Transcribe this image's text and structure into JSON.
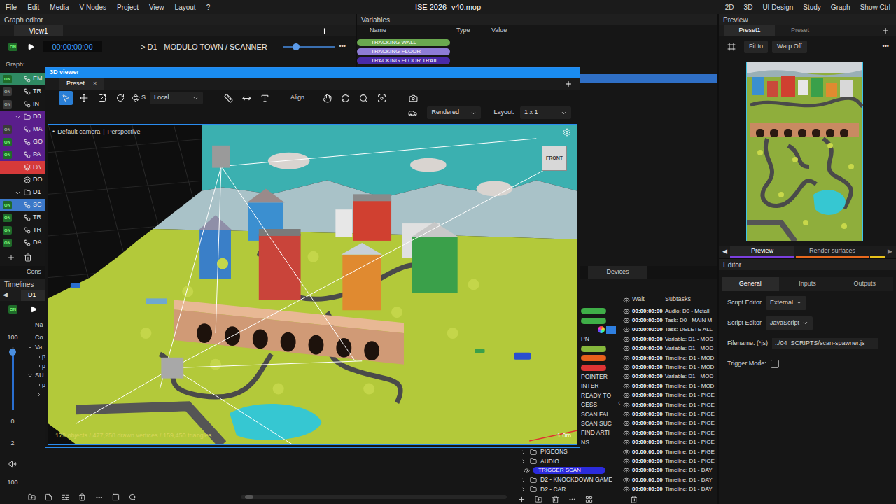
{
  "menu": [
    "File",
    "Edit",
    "Media",
    "V-Nodes",
    "Project",
    "View",
    "Layout",
    "?"
  ],
  "title": "ISE 2026 -v40.mop",
  "workspaces": [
    "2D",
    "3D",
    "UI Design",
    "Study",
    "Graph",
    "Show Ctrl"
  ],
  "graph_editor": {
    "title": "Graph editor",
    "tabs": [
      {
        "label": "View1",
        "selected": true
      }
    ],
    "on_label": "ON",
    "transport_on": true,
    "timecode": "00:00:00:00",
    "path": "> D1 - MODULO TOWN / SCANNER",
    "zoom": 0.22,
    "more": "•••",
    "graph_label": "Graph:",
    "rows": [
      {
        "kind": "node",
        "label": "EM",
        "on": true,
        "color": "#2f8a63"
      },
      {
        "kind": "node",
        "label": "TR",
        "on": false
      },
      {
        "kind": "node",
        "label": "IN",
        "on": false
      },
      {
        "kind": "folder",
        "label": "D0",
        "expanded": true,
        "color": "#5a1e8c"
      },
      {
        "kind": "node",
        "label": "MA",
        "on": false,
        "color": "#5a1e8c"
      },
      {
        "kind": "node",
        "label": "GO",
        "on": true,
        "color": "#5a1e8c"
      },
      {
        "kind": "node",
        "label": "PA",
        "on": true,
        "color": "#5a1e8c"
      },
      {
        "kind": "layer",
        "label": "PA",
        "color": "#d63a3a"
      },
      {
        "kind": "layer",
        "label": "DO"
      },
      {
        "kind": "folder",
        "label": "D1",
        "expanded": true
      },
      {
        "kind": "node",
        "label": "SC",
        "on": true,
        "color": "#3b78c8"
      },
      {
        "kind": "node",
        "label": "TR",
        "on": true
      },
      {
        "kind": "node",
        "label": "TR",
        "on": true
      },
      {
        "kind": "node",
        "label": "DA",
        "on": true
      }
    ]
  },
  "variables": {
    "title": "Variables",
    "columns": [
      "Name",
      "Type",
      "Value"
    ],
    "rows": [
      {
        "name": "TRACKING WALL",
        "color": "#6aa84f",
        "selected": false
      },
      {
        "name": "TRACKING FLOOR",
        "color": "#8e7cd6",
        "selected": false
      },
      {
        "name": "TRACKING FLOOR TRAIL",
        "color": "#4a2aa8",
        "selected": false
      },
      {
        "name": "",
        "selected": false
      },
      {
        "name": "",
        "selected": true
      }
    ]
  },
  "panel_tabs": {
    "left": "Cons",
    "right": "Devices"
  },
  "timelines": {
    "title": "Timelines",
    "prev": "◀",
    "tabs": [
      {
        "label": "D1 -",
        "selected": true
      }
    ],
    "on": true,
    "name_header": "Na",
    "volume_max": "100",
    "volume_level": 0.97,
    "volume_min": "0",
    "speed": "2",
    "gain": "100",
    "tree": [
      {
        "kind": "header",
        "label": "Co"
      },
      {
        "kind": "group",
        "label": "Va",
        "expanded": true
      },
      {
        "kind": "item",
        "label": "p",
        "expanded": false
      },
      {
        "kind": "item",
        "label": "p",
        "expanded": false
      },
      {
        "kind": "group",
        "label": "SU",
        "expanded": true
      },
      {
        "kind": "item",
        "label": "p",
        "expanded": false
      },
      {
        "kind": "item",
        "label": "",
        "expanded": false
      }
    ]
  },
  "tasks": {
    "collapse": "‹",
    "columns": [
      "Wait",
      "Subtasks"
    ],
    "rows": [
      {
        "kind": "pill",
        "color": "#3fae48"
      },
      {
        "kind": "pill",
        "color": "#3fae48"
      },
      {
        "kind": "swatch",
        "selected": true
      },
      {
        "kind": "cut",
        "label": "PN"
      },
      {
        "kind": "pill",
        "color": "#86b83c"
      },
      {
        "kind": "pill",
        "color": "#e8601c"
      },
      {
        "kind": "pill",
        "color": "#de3434"
      },
      {
        "kind": "cut",
        "label": "POINTER"
      },
      {
        "kind": "cut",
        "label": "INTER"
      },
      {
        "kind": "cut",
        "label": "READY TO"
      },
      {
        "kind": "cut",
        "label": "CESS"
      },
      {
        "kind": "cut",
        "label": "SCAN FAI"
      },
      {
        "kind": "cut",
        "label": "SCAN SUC"
      },
      {
        "kind": "cut",
        "label": "FIND ARTI"
      },
      {
        "kind": "cut",
        "label": "NS"
      },
      {
        "kind": "folder",
        "label": "PIGEONS",
        "expanded": false
      },
      {
        "kind": "folder",
        "label": "AUDIO",
        "expanded": false
      },
      {
        "kind": "trigger",
        "label": "TRIGGER SCAN",
        "color": "#2b2bdc"
      },
      {
        "kind": "folder",
        "label": "D2 - KNOCKDOWN GAME",
        "expanded": false
      },
      {
        "kind": "folder",
        "label": "D2 - CAR",
        "expanded": false
      }
    ],
    "subtasks": [
      {
        "wait": "00:00:00:00",
        "task": "Audio: D0 - Metall"
      },
      {
        "wait": "00:00:00:00",
        "task": "Task: D0 - MAIN M"
      },
      {
        "wait": "00:00:00:00",
        "task": "Task: DELETE ALL"
      },
      {
        "wait": "00:00:00:00",
        "task": "Variable: D1 - MOD"
      },
      {
        "wait": "00:00:00:00",
        "task": "Variable: D1 - MOD"
      },
      {
        "wait": "00:00:00:00",
        "task": "Timeline: D1 - MOD"
      },
      {
        "wait": "00:00:00:00",
        "task": "Timeline: D1 - MOD"
      },
      {
        "wait": "00:00:00:00",
        "task": "Variable: D1 - MOD"
      },
      {
        "wait": "00:00:00:00",
        "task": "Timeline: D1 - MOD"
      },
      {
        "wait": "00:00:00:00",
        "task": "Timeline: D1 - PIGE"
      },
      {
        "wait": "00:00:00:00",
        "task": "Timeline: D1 - PIGE"
      },
      {
        "wait": "00:00:00:00",
        "task": "Timeline: D1 - PIGE"
      },
      {
        "wait": "00:00:00:00",
        "task": "Timeline: D1 - PIGE"
      },
      {
        "wait": "00:00:00:00",
        "task": "Timeline: D1 - PIGE"
      },
      {
        "wait": "00:00:00:00",
        "task": "Timeline: D1 - PIGE"
      },
      {
        "wait": "00:00:00:00",
        "task": "Timeline: D1 - PIGE"
      },
      {
        "wait": "00:00:00:00",
        "task": "Timeline: D1 - PIGE"
      },
      {
        "wait": "00:00:00:00",
        "task": "Timeline: D1 - DAY"
      },
      {
        "wait": "00:00:00:00",
        "task": "Timeline: D1 - DAY"
      },
      {
        "wait": "00:00:00:00",
        "task": "Timeline: D1 - DAY"
      }
    ]
  },
  "preview": {
    "title": "Preview",
    "tabs": [
      {
        "label": "Preset1",
        "selected": true
      },
      {
        "label": "Preset",
        "selected": false
      }
    ],
    "buttons": [
      "Fit to",
      "Warp Off"
    ],
    "more": "•••",
    "prev": "◀",
    "next": "▶",
    "bottom_tabs": [
      {
        "label": "Preview",
        "selected": true,
        "color": "#7b3fe0"
      },
      {
        "label": "Render surfaces",
        "selected": false,
        "color": "#e8691e"
      },
      {
        "label": "",
        "selected": false,
        "color": "#e8c21a"
      }
    ]
  },
  "editor": {
    "title": "Editor",
    "tabs": [
      {
        "label": "General",
        "selected": true
      },
      {
        "label": "Inputs",
        "selected": false
      },
      {
        "label": "Outputs",
        "selected": false
      }
    ],
    "fields": [
      {
        "kind": "select",
        "label": "Script Editor",
        "value": "External"
      },
      {
        "kind": "select",
        "label": "Script Editor",
        "value": "JavaScript"
      },
      {
        "kind": "text",
        "label": "Filename: (*js)",
        "value": "../04_SCRIPTS/scan-spawner.js"
      },
      {
        "kind": "checkbox",
        "label": "Trigger Mode:",
        "checked": false
      }
    ]
  },
  "viewer": {
    "title": "3D viewer",
    "tabs": [
      {
        "label": "Preset",
        "selected": true
      }
    ],
    "close": "×",
    "tools": [
      {
        "kind": "select",
        "selected": true
      },
      {
        "kind": "move",
        "selected": false
      },
      {
        "kind": "scale",
        "selected": false
      },
      {
        "kind": "rotate",
        "selected": false
      },
      {
        "kind": "orbit",
        "selected": false
      }
    ],
    "snap": "S",
    "space": "Local",
    "align": "Align",
    "shading": "Rendered",
    "layout_label": "Layout:",
    "layout": "1 x 1",
    "camera_bullet": "•",
    "camera": "Default camera",
    "separator": "|",
    "projection": "Perspective",
    "cube_face": "FRONT",
    "stats": "179 objects / 477,258 drawn vertices / 159,450 triangles",
    "scale": "1.0m"
  }
}
